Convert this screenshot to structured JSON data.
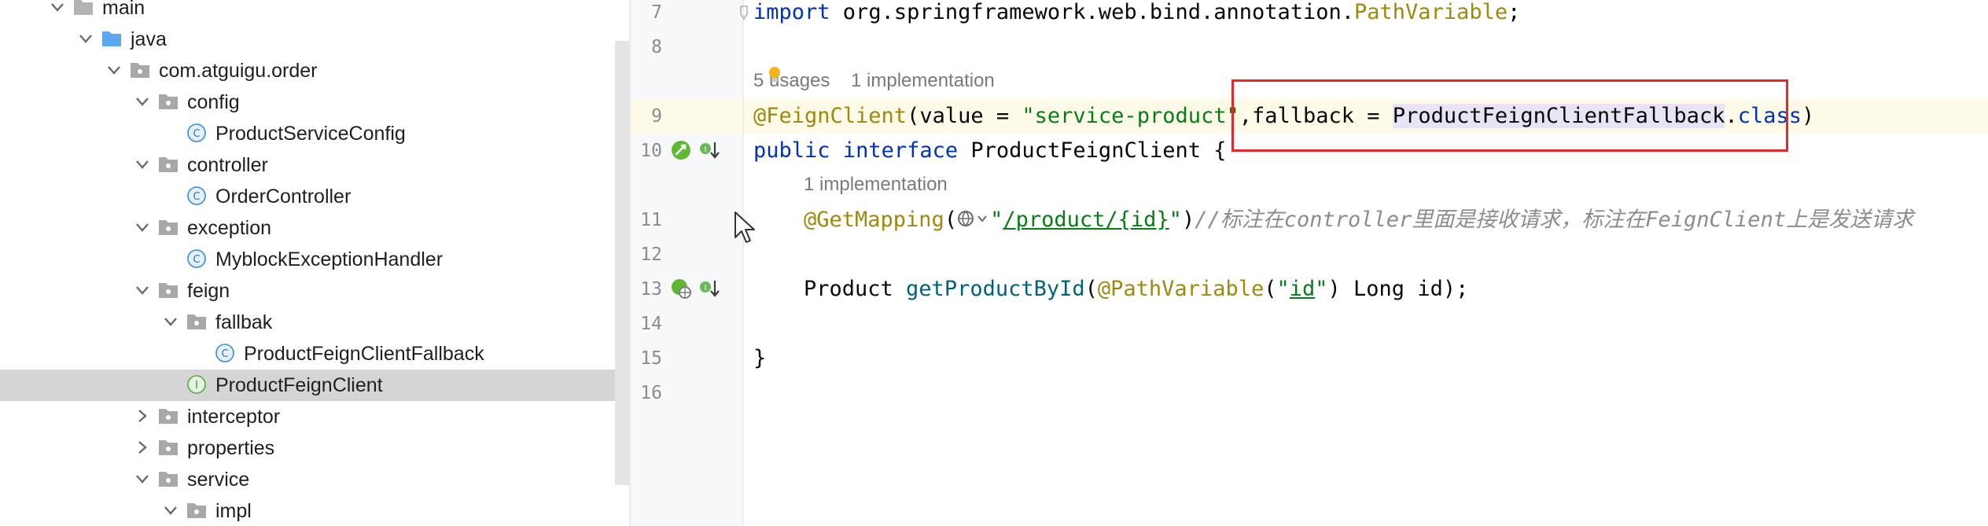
{
  "project_tree": {
    "items": [
      {
        "label": "main",
        "icon": "folder-icon",
        "expanded": true
      },
      {
        "label": "java",
        "icon": "source-folder-icon",
        "expanded": true
      },
      {
        "label": "com.atguigu.order",
        "icon": "package-icon",
        "expanded": true
      },
      {
        "label": "config",
        "icon": "package-icon",
        "expanded": true
      },
      {
        "label": "ProductServiceConfig",
        "icon": "class-icon"
      },
      {
        "label": "controller",
        "icon": "package-icon",
        "expanded": true
      },
      {
        "label": "OrderController",
        "icon": "class-icon"
      },
      {
        "label": "exception",
        "icon": "package-icon",
        "expanded": true
      },
      {
        "label": "MyblockExceptionHandler",
        "icon": "class-icon"
      },
      {
        "label": "feign",
        "icon": "package-icon",
        "expanded": true
      },
      {
        "label": "fallbak",
        "icon": "package-icon",
        "expanded": true
      },
      {
        "label": "ProductFeignClientFallback",
        "icon": "class-icon"
      },
      {
        "label": "ProductFeignClient",
        "icon": "interface-icon",
        "selected": true
      },
      {
        "label": "interceptor",
        "icon": "package-icon",
        "expanded": false
      },
      {
        "label": "properties",
        "icon": "package-icon",
        "expanded": false
      },
      {
        "label": "service",
        "icon": "package-icon",
        "expanded": true
      },
      {
        "label": "impl",
        "icon": "package-icon",
        "expanded": true
      }
    ]
  },
  "editor": {
    "line_numbers": [
      "7",
      "8",
      "9",
      "10",
      "11",
      "12",
      "13",
      "14",
      "15",
      "16"
    ],
    "line7": {
      "import_kw": "import",
      "pkg": " org.springframework.web.bind.annotation.",
      "cls": "PathVariable",
      "end": ";"
    },
    "hint_usages": "5 usages",
    "hint_impl_1": "1 implementation",
    "line9": {
      "annotation": "@FeignClient",
      "open": "(value = ",
      "value_str": "\"service-product\"",
      "comma_fallback": ",fallback = ",
      "fallback_type": "ProductFeignClientFallback",
      "dot": ".",
      "class_kw": "class",
      "close": ")"
    },
    "line10": {
      "public_kw": "public",
      "interface_kw": "interface",
      "name": " ProductFeignClient {"
    },
    "hint_impl_2": "1 implementation",
    "line11": {
      "annotation": "@GetMapping",
      "open": "(",
      "quote_open": "\"",
      "path": "/product/{id}",
      "quote_close": "\"",
      "close": ")",
      "comment": "//标注在controller里面是接收请求，标注在FeignClient上是发送请求"
    },
    "line13": {
      "type": "Product ",
      "method": "getProductById",
      "open": "(",
      "annotation": "@PathVariable",
      "p_open": "(",
      "q1": "\"",
      "id_str": "id",
      "q2": "\"",
      "rest": ") Long id);"
    },
    "line15": "}"
  },
  "colors": {
    "keyword": "#0033b3",
    "annotation": "#9e880d",
    "string": "#067d17",
    "comment": "#8c8c8c",
    "highlight_box": "#e8262b",
    "selection_row": "#d5d5d5"
  }
}
